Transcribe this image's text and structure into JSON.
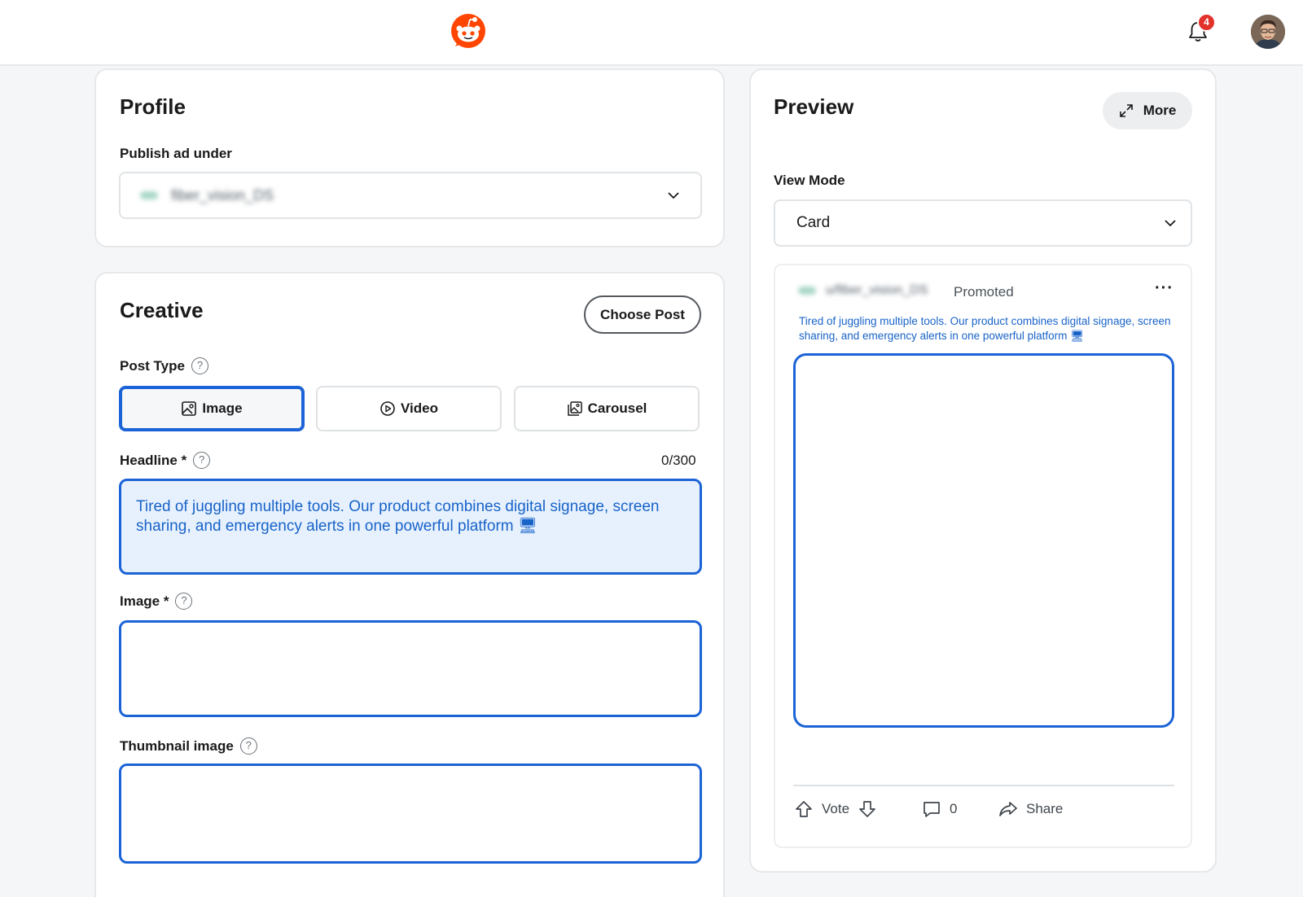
{
  "header": {
    "notification_count": "4"
  },
  "profile": {
    "title": "Profile",
    "publish_label": "Publish ad under",
    "account_value": "fiber_vision_DS"
  },
  "creative": {
    "title": "Creative",
    "choose_post": "Choose Post",
    "post_type_label": "Post Type",
    "post_types": [
      {
        "label": "Image",
        "selected": true
      },
      {
        "label": "Video",
        "selected": false
      },
      {
        "label": "Carousel",
        "selected": false
      }
    ],
    "headline_label": "Headline *",
    "headline_counter": "0/300",
    "headline_value": "Tired of juggling multiple tools. Our product combines digital signage, screen sharing, and emergency alerts in one powerful platform 🖥",
    "image_label": "Image *",
    "thumbnail_label": "Thumbnail image"
  },
  "preview": {
    "title": "Preview",
    "more": "More",
    "view_mode_label": "View Mode",
    "view_mode_value": "Card",
    "post": {
      "author": "u/fiber_vision_DS",
      "promoted": "Promoted",
      "text": "Tired of juggling multiple tools. Our product combines digital signage, screen sharing, and emergency alerts in one powerful platform 🖥",
      "vote": "Vote",
      "comments": "0",
      "share": "Share"
    }
  },
  "colors": {
    "accent": "#1b63d6",
    "brand": "#ff4500",
    "headline_text": "#1863c8"
  }
}
